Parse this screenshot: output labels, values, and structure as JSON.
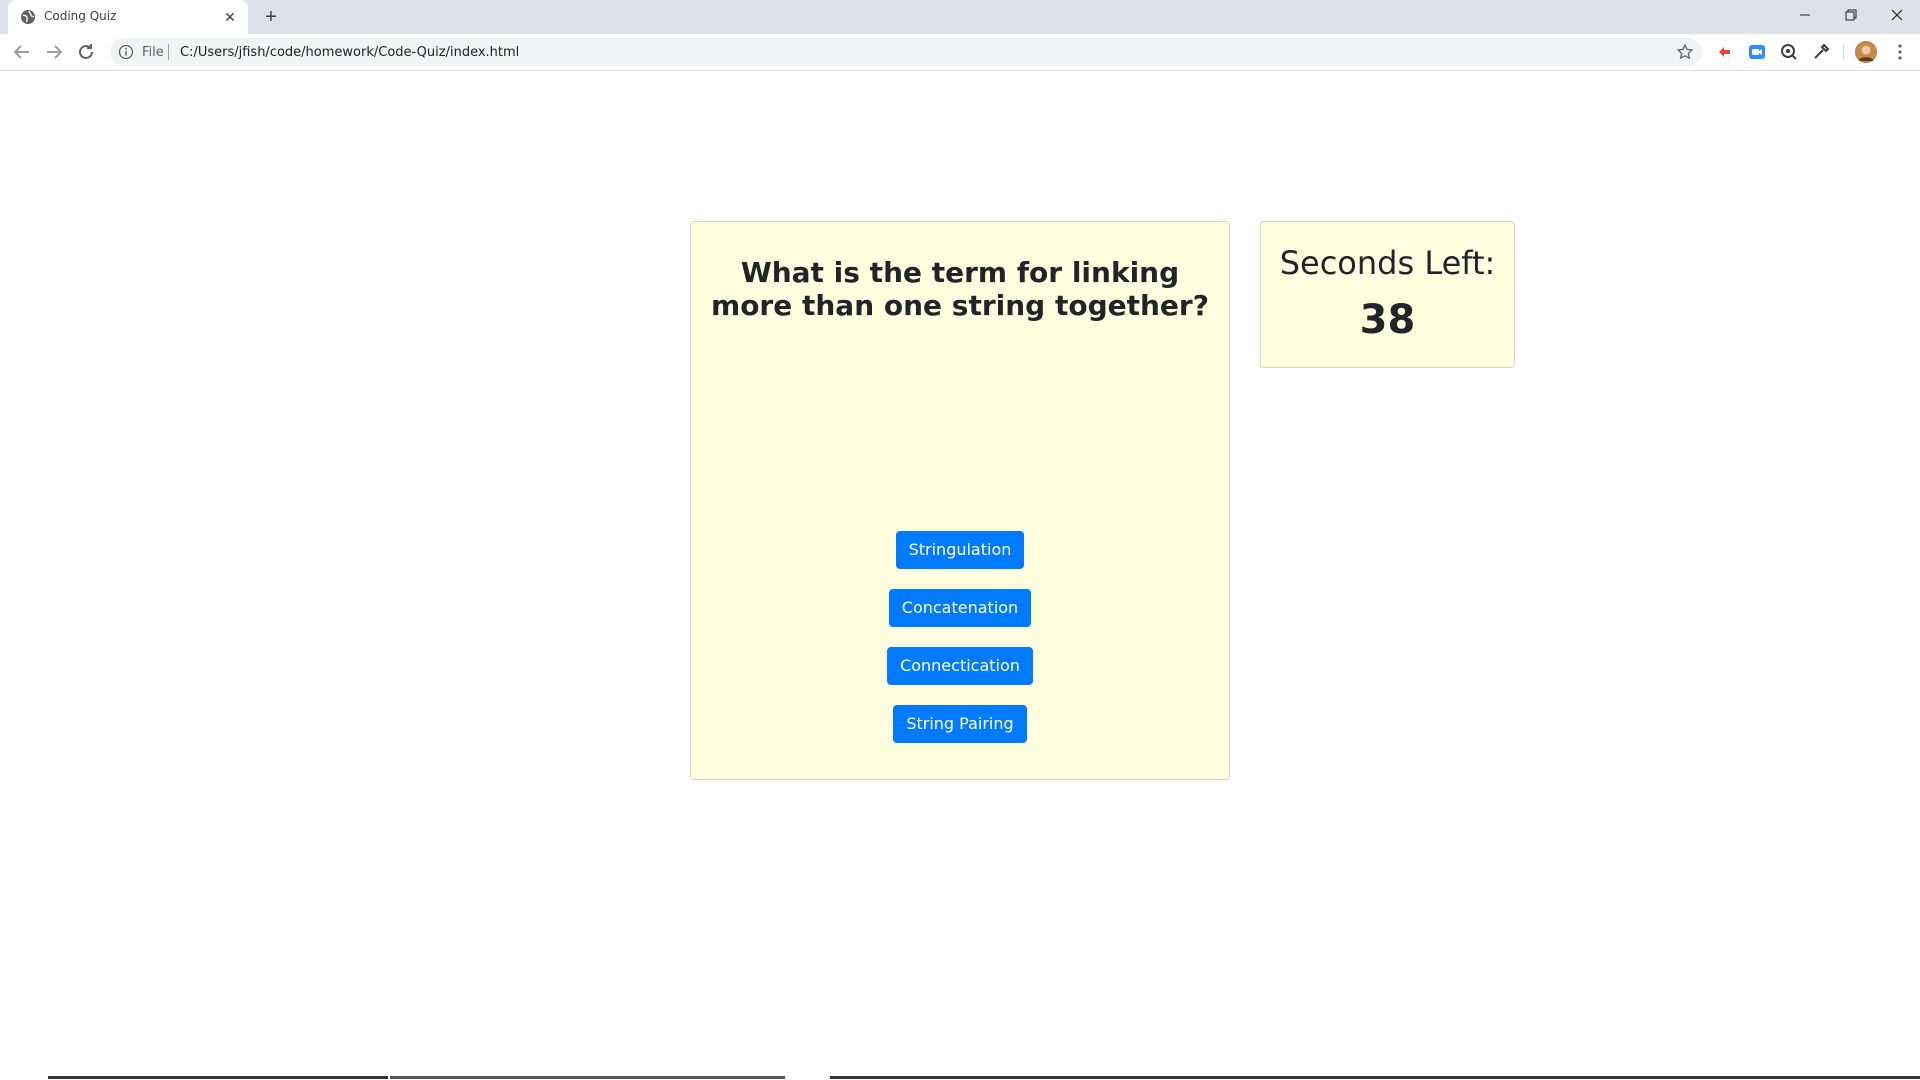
{
  "browser": {
    "tab_title": "Coding Quiz",
    "tab_close_icon": "close-icon",
    "new_tab_icon": "plus-icon",
    "address": {
      "scheme_label": "File",
      "url": "C:/Users/jfish/code/homework/Code-Quiz/index.html"
    }
  },
  "quiz": {
    "question": "What is the term for linking more than one string together?",
    "answers": [
      "Stringulation",
      "Concatenation",
      "Connectication",
      "String Pairing"
    ],
    "button_color": "#007bff",
    "card_color": "#ffffe0"
  },
  "timer": {
    "label": "Seconds Left:",
    "value": "38"
  }
}
